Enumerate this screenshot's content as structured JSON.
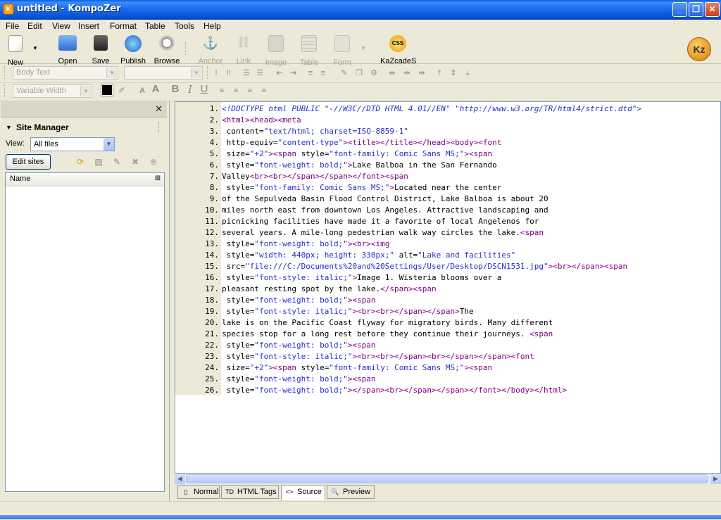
{
  "window": {
    "title": "untitled - KompoZer"
  },
  "menu": [
    "File",
    "Edit",
    "View",
    "Insert",
    "Format",
    "Table",
    "Tools",
    "Help"
  ],
  "toolbar": {
    "new": "New",
    "open": "Open",
    "save": "Save",
    "publish": "Publish",
    "browse": "Browse",
    "anchor": "Anchor",
    "link": "Link",
    "image": "Image",
    "table": "Table",
    "form": "Form",
    "kazcades": "KaZcadeS",
    "kazcades_badge": "CSS"
  },
  "format": {
    "paragraph_style": "Body Text",
    "font_width": "Variable Width"
  },
  "site_manager": {
    "title": "Site Manager",
    "view_label": "View:",
    "view_value": "All files",
    "edit_sites": "Edit sites",
    "column_name": "Name"
  },
  "tabs": [
    "Normal",
    "HTML Tags",
    "Source",
    "Preview"
  ],
  "active_tab": "Source",
  "colors": {
    "tag": "#800080",
    "value": "#2b2bd1",
    "titlebar": "#0a5fe4"
  },
  "source_lines": [
    [
      [
        "doctype",
        "<!DOCTYPE html PUBLIC \"-//W3C//DTD HTML 4.01//EN\" \"http://www.w3.org/TR/html4/strict.dtd\">"
      ]
    ],
    [
      [
        "tag",
        "<html><head><meta"
      ]
    ],
    [
      [
        "attr",
        " content="
      ],
      [
        "val",
        "\"text/html; charset=ISO-8859-1\""
      ]
    ],
    [
      [
        "attr",
        " http-equiv="
      ],
      [
        "val",
        "\"content-type\""
      ],
      [
        "tag",
        "><title></title></head><body><font"
      ]
    ],
    [
      [
        "attr",
        " size="
      ],
      [
        "val",
        "\"+2\""
      ],
      [
        "tag",
        "><span "
      ],
      [
        "attr",
        "style="
      ],
      [
        "val",
        "\"font-family: Comic Sans MS;\""
      ],
      [
        "tag",
        "><span"
      ]
    ],
    [
      [
        "attr",
        " style="
      ],
      [
        "val",
        "\"font-weight: bold;\""
      ],
      [
        "tag",
        ">"
      ],
      [
        "txt",
        "Lake Balboa in the San Fernando"
      ]
    ],
    [
      [
        "txt",
        "Valley"
      ],
      [
        "tag",
        "<br><br></span></span></font><span"
      ]
    ],
    [
      [
        "attr",
        " style="
      ],
      [
        "val",
        "\"font-family: Comic Sans MS;\""
      ],
      [
        "tag",
        ">"
      ],
      [
        "txt",
        "Located near the center"
      ]
    ],
    [
      [
        "txt",
        "of the Sepulveda Basin Flood Control District, Lake Balboa is about 20"
      ]
    ],
    [
      [
        "txt",
        "miles north east from downtown Los Angeles. Attractive landscaping and"
      ]
    ],
    [
      [
        "txt",
        "picnicking facilities have made it a favorite of local Angelenos for"
      ]
    ],
    [
      [
        "txt",
        "several years. A mile-long pedestrian walk way circles the lake."
      ],
      [
        "tag",
        "<span"
      ]
    ],
    [
      [
        "attr",
        " style="
      ],
      [
        "val",
        "\"font-weight: bold;\""
      ],
      [
        "tag",
        "><br><img"
      ]
    ],
    [
      [
        "attr",
        " style="
      ],
      [
        "val",
        "\"width: 440px; height: 330px;\""
      ],
      [
        "attr",
        " alt="
      ],
      [
        "val",
        "\"Lake and facilities\""
      ]
    ],
    [
      [
        "attr",
        " src="
      ],
      [
        "val",
        "\"file:///C:/Documents%20and%20Settings/User/Desktop/DSCN1531.jpg\""
      ],
      [
        "tag",
        "><br></span><span"
      ]
    ],
    [
      [
        "attr",
        " style="
      ],
      [
        "val",
        "\"font-style: italic;\""
      ],
      [
        "tag",
        ">"
      ],
      [
        "txt",
        "Image 1. Wisteria blooms over a"
      ]
    ],
    [
      [
        "txt",
        "pleasant resting spot by the lake."
      ],
      [
        "tag",
        "</span><span"
      ]
    ],
    [
      [
        "attr",
        " style="
      ],
      [
        "val",
        "\"font-weight: bold;\""
      ],
      [
        "tag",
        "><span"
      ]
    ],
    [
      [
        "attr",
        " style="
      ],
      [
        "val",
        "\"font-style: italic;\""
      ],
      [
        "tag",
        "><br><br></span></span>"
      ],
      [
        "txt",
        "The"
      ]
    ],
    [
      [
        "txt",
        "lake is on the Pacific Coast flyway for migratory birds. Many different"
      ]
    ],
    [
      [
        "txt",
        "species stop for a long rest before they continue their journeys. "
      ],
      [
        "tag",
        "<span"
      ]
    ],
    [
      [
        "attr",
        " style="
      ],
      [
        "val",
        "\"font-weight: bold;\""
      ],
      [
        "tag",
        "><span"
      ]
    ],
    [
      [
        "attr",
        " style="
      ],
      [
        "val",
        "\"font-style: italic;\""
      ],
      [
        "tag",
        "><br><br></span><br></span></span><font"
      ]
    ],
    [
      [
        "attr",
        " size="
      ],
      [
        "val",
        "\"+2\""
      ],
      [
        "tag",
        "><span "
      ],
      [
        "attr",
        "style="
      ],
      [
        "val",
        "\"font-family: Comic Sans MS;\""
      ],
      [
        "tag",
        "><span"
      ]
    ],
    [
      [
        "attr",
        " style="
      ],
      [
        "val",
        "\"font-weight: bold;\""
      ],
      [
        "tag",
        "><span"
      ]
    ],
    [
      [
        "attr",
        " style="
      ],
      [
        "val",
        "\"font-weight: bold;\""
      ],
      [
        "tag",
        "></span><br></span></span></font></body></html>"
      ]
    ]
  ]
}
